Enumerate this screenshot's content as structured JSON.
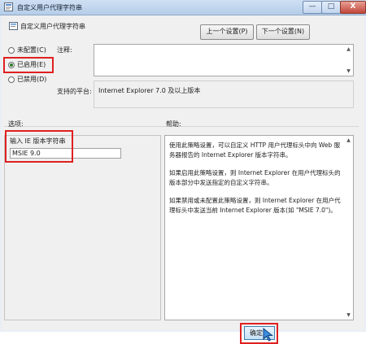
{
  "window": {
    "title": "自定义用户代理字符串",
    "caption_buttons": [
      "—",
      "□",
      "X"
    ]
  },
  "header": {
    "setting_name": "自定义用户代理字符串",
    "prev_button": "上一个设置(P)",
    "next_button": "下一个设置(N)"
  },
  "state_options": [
    {
      "label": "未配置(C)",
      "selected": false
    },
    {
      "label": "已启用(E)",
      "selected": true
    },
    {
      "label": "已禁用(D)",
      "selected": false
    }
  ],
  "comment": {
    "label": "注释:",
    "value": ""
  },
  "platform": {
    "label": "支持的平台:",
    "value": "Internet Explorer 7.0 及以上版本"
  },
  "options": {
    "label": "选项:",
    "field_label": "输入 IE 版本字符串",
    "field_value": "MSIE 9.0"
  },
  "help": {
    "label": "帮助:",
    "paragraphs": [
      "使用此策略设置，可以自定义 HTTP 用户代理标头中向 Web 服务器报告的 Internet Explorer 版本字符串。",
      "如果启用此策略设置，则 Internet Explorer 在用户代理标头的版本部分中发送指定的自定义字符串。",
      "如果禁用或未配置此策略设置，则 Internet Explorer 在用户代理标头中发送当前 Internet Explorer 版本(如 \"MSIE 7.0\")。"
    ]
  },
  "footer": {
    "ok_button": "确定"
  },
  "colors": {
    "highlight_box": "#e02020",
    "titlebar": "#b5cde9"
  }
}
